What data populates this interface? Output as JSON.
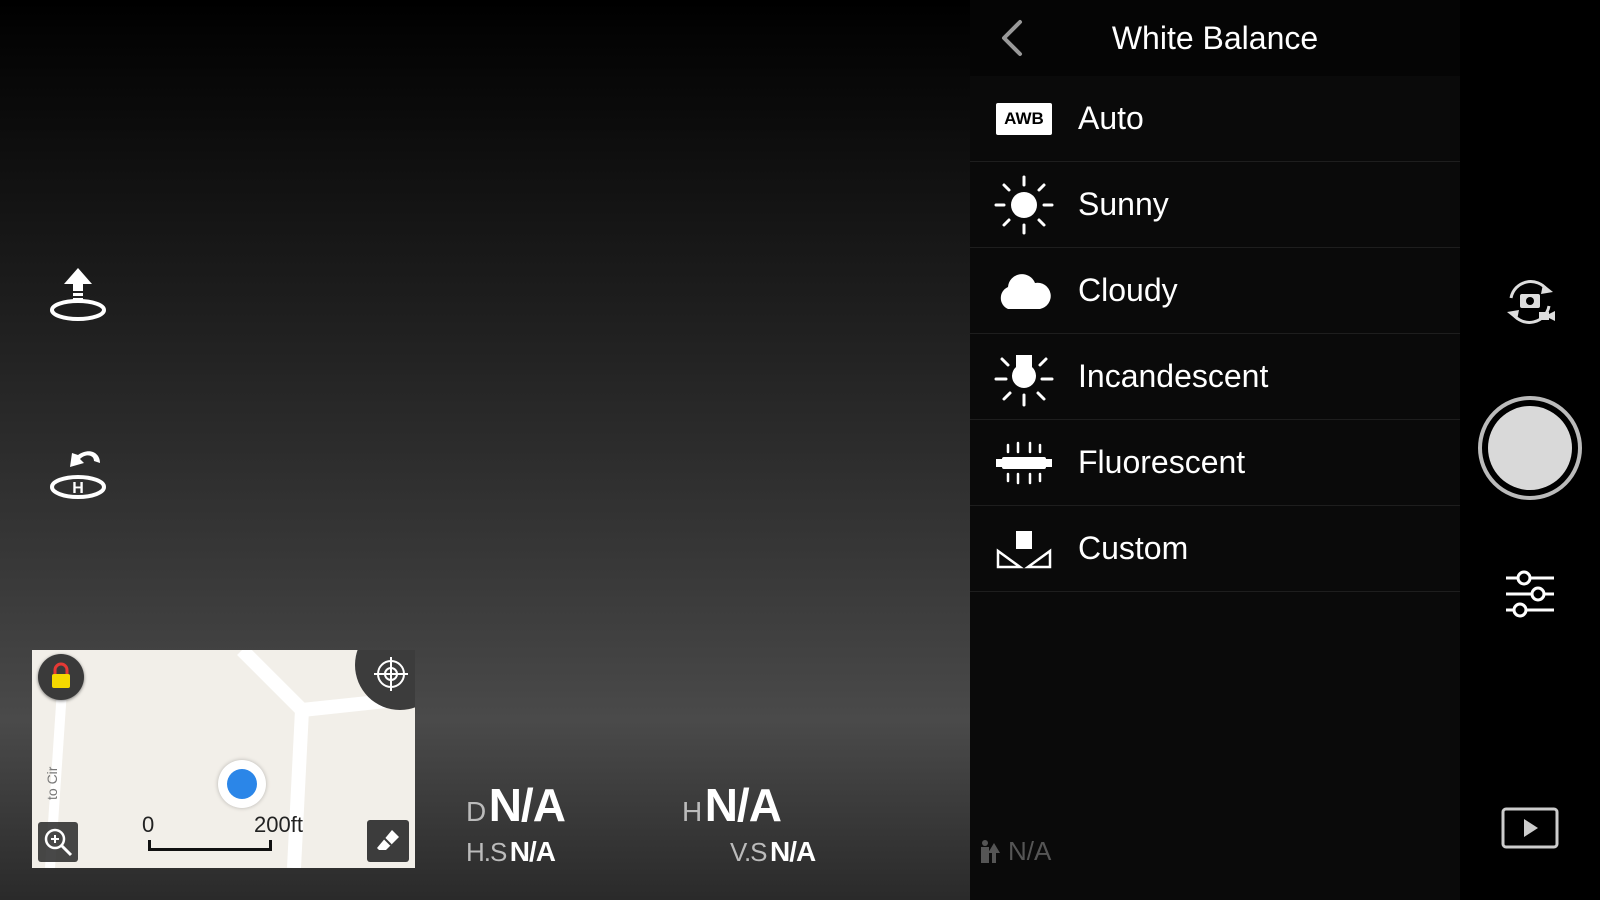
{
  "panel": {
    "title": "White Balance",
    "items": [
      {
        "label": "Auto",
        "icon": "awb-icon",
        "icon_text": "AWB"
      },
      {
        "label": "Sunny",
        "icon": "sun-icon"
      },
      {
        "label": "Cloudy",
        "icon": "cloud-icon"
      },
      {
        "label": "Incandescent",
        "icon": "incandescent-icon"
      },
      {
        "label": "Fluorescent",
        "icon": "fluorescent-icon"
      },
      {
        "label": "Custom",
        "icon": "custom-icon"
      }
    ]
  },
  "telemetry": {
    "d_label": "D",
    "d_value": "N/A",
    "h_label": "H",
    "h_value": "N/A",
    "hs_label": "H.S",
    "hs_value": "N/A",
    "vs_label": "V.S",
    "vs_value": "N/A",
    "alt_value": "N/A"
  },
  "map": {
    "scale_start": "0",
    "scale_end": "200ft",
    "street": "to Cir"
  },
  "colors": {
    "drone_dot": "#2b86e8",
    "lock_yellow": "#f5d800"
  }
}
